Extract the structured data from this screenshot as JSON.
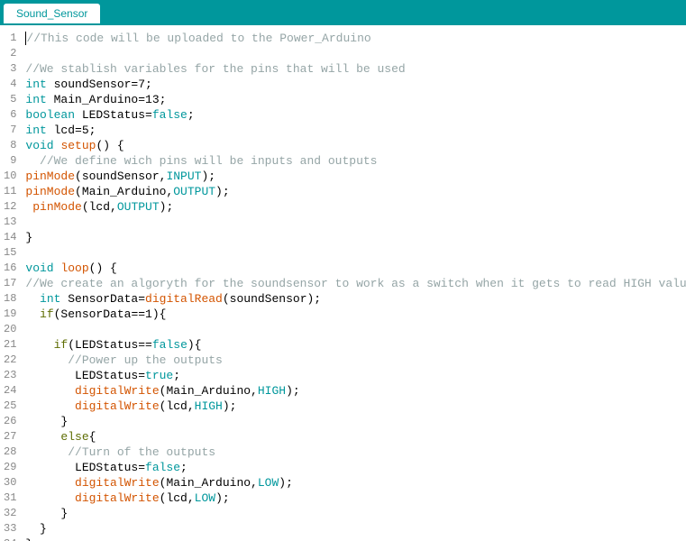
{
  "tab": {
    "title": "Sound_Sensor"
  },
  "code": {
    "lines": [
      [
        [
          "com",
          "//This code will be uploaded to the Power_Arduino"
        ]
      ],
      [],
      [
        [
          "com",
          "//We stablish variables for the pins that will be used"
        ]
      ],
      [
        [
          "type",
          "int"
        ],
        [
          "txt",
          " soundSensor=7;"
        ]
      ],
      [
        [
          "type",
          "int"
        ],
        [
          "txt",
          " Main_Arduino=13;"
        ]
      ],
      [
        [
          "type",
          "boolean"
        ],
        [
          "txt",
          " LEDStatus="
        ],
        [
          "lit",
          "false"
        ],
        [
          "txt",
          ";"
        ]
      ],
      [
        [
          "type",
          "int"
        ],
        [
          "txt",
          " lcd=5;"
        ]
      ],
      [
        [
          "type",
          "void"
        ],
        [
          "txt",
          " "
        ],
        [
          "func",
          "setup"
        ],
        [
          "txt",
          "() {"
        ]
      ],
      [
        [
          "txt",
          "  "
        ],
        [
          "com",
          "//We define wich pins will be inputs and outputs"
        ]
      ],
      [
        [
          "func",
          "pinMode"
        ],
        [
          "txt",
          "(soundSensor,"
        ],
        [
          "lit",
          "INPUT"
        ],
        [
          "txt",
          ");"
        ]
      ],
      [
        [
          "func",
          "pinMode"
        ],
        [
          "txt",
          "(Main_Arduino,"
        ],
        [
          "lit",
          "OUTPUT"
        ],
        [
          "txt",
          ");"
        ]
      ],
      [
        [
          "txt",
          " "
        ],
        [
          "func",
          "pinMode"
        ],
        [
          "txt",
          "(lcd,"
        ],
        [
          "lit",
          "OUTPUT"
        ],
        [
          "txt",
          ");"
        ]
      ],
      [],
      [
        [
          "txt",
          "}"
        ]
      ],
      [],
      [
        [
          "type",
          "void"
        ],
        [
          "txt",
          " "
        ],
        [
          "func",
          "loop"
        ],
        [
          "txt",
          "() {"
        ]
      ],
      [
        [
          "com",
          "//We create an algoryth for the soundsensor to work as a switch when it gets to read HIGH values"
        ]
      ],
      [
        [
          "txt",
          "  "
        ],
        [
          "type",
          "int"
        ],
        [
          "txt",
          " SensorData="
        ],
        [
          "func",
          "digitalRead"
        ],
        [
          "txt",
          "(soundSensor);"
        ]
      ],
      [
        [
          "txt",
          "  "
        ],
        [
          "kw",
          "if"
        ],
        [
          "txt",
          "(SensorData==1){"
        ]
      ],
      [],
      [
        [
          "txt",
          "    "
        ],
        [
          "kw",
          "if"
        ],
        [
          "txt",
          "(LEDStatus=="
        ],
        [
          "lit",
          "false"
        ],
        [
          "txt",
          "){"
        ]
      ],
      [
        [
          "txt",
          "      "
        ],
        [
          "com",
          "//Power up the outputs"
        ]
      ],
      [
        [
          "txt",
          "       LEDStatus="
        ],
        [
          "lit",
          "true"
        ],
        [
          "txt",
          ";"
        ]
      ],
      [
        [
          "txt",
          "       "
        ],
        [
          "func",
          "digitalWrite"
        ],
        [
          "txt",
          "(Main_Arduino,"
        ],
        [
          "lit",
          "HIGH"
        ],
        [
          "txt",
          ");"
        ]
      ],
      [
        [
          "txt",
          "       "
        ],
        [
          "func",
          "digitalWrite"
        ],
        [
          "txt",
          "(lcd,"
        ],
        [
          "lit",
          "HIGH"
        ],
        [
          "txt",
          ");"
        ]
      ],
      [
        [
          "txt",
          "     }"
        ]
      ],
      [
        [
          "txt",
          "     "
        ],
        [
          "kw",
          "else"
        ],
        [
          "txt",
          "{"
        ]
      ],
      [
        [
          "txt",
          "      "
        ],
        [
          "com",
          "//Turn of the outputs"
        ]
      ],
      [
        [
          "txt",
          "       LEDStatus="
        ],
        [
          "lit",
          "false"
        ],
        [
          "txt",
          ";"
        ]
      ],
      [
        [
          "txt",
          "       "
        ],
        [
          "func",
          "digitalWrite"
        ],
        [
          "txt",
          "(Main_Arduino,"
        ],
        [
          "lit",
          "LOW"
        ],
        [
          "txt",
          ");"
        ]
      ],
      [
        [
          "txt",
          "       "
        ],
        [
          "func",
          "digitalWrite"
        ],
        [
          "txt",
          "(lcd,"
        ],
        [
          "lit",
          "LOW"
        ],
        [
          "txt",
          ");"
        ]
      ],
      [
        [
          "txt",
          "     }"
        ]
      ],
      [
        [
          "txt",
          "  }"
        ]
      ],
      [
        [
          "txt",
          "}"
        ]
      ]
    ]
  }
}
